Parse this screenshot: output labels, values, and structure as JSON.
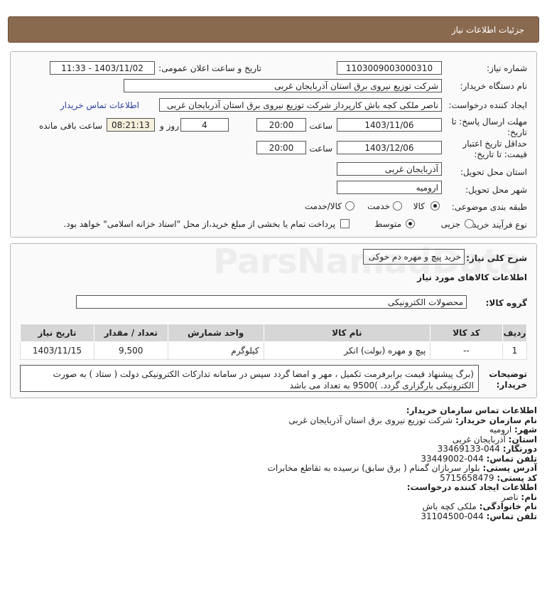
{
  "header": {
    "title": "جزئیات اطلاعات نیاز"
  },
  "form": {
    "need_number_label": "شماره نیاز:",
    "need_number": "1103009003000310",
    "announce_label": "تاریخ و ساعت اعلان عمومی:",
    "announce_value": "1403/11/02 - 11:33",
    "buyer_org_label": "نام دستگاه خریدار:",
    "buyer_org": "شرکت توزیع نیروی برق استان آذربایجان غربی",
    "creator_label": "ایجاد کننده درخواست:",
    "creator": "ناصر ملکی کچه باش کارپرداز شرکت توزیع نیروی برق استان آذربایجان غربی",
    "buyer_contact_link": "اطلاعات تماس خریدار",
    "deadline_label_1": "مهلت ارسال پاسخ: تا",
    "deadline_label_2": "تاریخ:",
    "deadline_date": "1403/11/06",
    "time_label": "ساعت",
    "deadline_time": "20:00",
    "days_value": "4",
    "days_label": "روز و",
    "remaining_time": "08:21:13",
    "remaining_label": "ساعت باقی مانده",
    "validity_label_1": "حداقل تاریخ اعتبار",
    "validity_label_2": "قیمت: تا تاریخ:",
    "validity_date": "1403/12/06",
    "validity_time": "20:00",
    "province_label": "استان محل تحویل:",
    "province": "آذربایجان غربی",
    "city_label": "شهر محل تحویل:",
    "city": "ارومیه",
    "category_label": "طبقه بندی موضوعی:",
    "category_options": [
      "کالا",
      "خدمت",
      "کالا/خدمت"
    ],
    "category_selected": "کالا",
    "process_label": "نوع فرآیند خرید :",
    "process_options": [
      "جزیی",
      "متوسط"
    ],
    "process_selected": "متوسط",
    "payment_note": "پرداخت تمام یا بخشی از مبلغ خرید،از محل \"اسناد خزانه اسلامی\" خواهد بود."
  },
  "need": {
    "desc_label": "شرح کلی نیاز:",
    "desc": "خرید پیچ و مهره دم خوکی",
    "goods_info_title": "اطلاعات کالاهای مورد نیاز",
    "group_label": "گروه کالا:",
    "group_value": "محصولات الکترونیکی",
    "table": {
      "headers": [
        "ردیف",
        "کد کالا",
        "نام کالا",
        "واحد شمارش",
        "تعداد / مقدار",
        "تاریخ نیاز"
      ],
      "rows": [
        [
          "1",
          "--",
          "پیچ و مهره (بولت) انکر",
          "کیلوگرم",
          "9,500",
          "1403/11/15"
        ]
      ]
    },
    "notes_label_1": "توضیحات",
    "notes_label_2": "خریدار:",
    "notes": "(برگ پیشنهاد قیمت برابرفرمت تکمیل ، مهر و امضا گردد سپس در سامانه تدارکات الکترونیکی دولت ( ستاد ) به صورت الکترونیکی بارگزاری گردد. )9500 به تعداد می باشد"
  },
  "contact": {
    "title": "اطلاعات تماس سازمان خریدار:",
    "org_label": "نام سازمان خریدار:",
    "org": "شرکت توزیع نیروی برق استان آذربایجان غربی",
    "city_label": "شهر:",
    "city": "ارومیه",
    "province_label": "استان:",
    "province": "آذربایجان غربی",
    "fax_label": "دورنگار:",
    "fax": "044-33469133",
    "phone_label": "تلفن تماس:",
    "phone": "044-33449002",
    "address_label": "آدرس پستی:",
    "address": "بلوار سربازان گمنام ( برق سابق) نرسیده به تقاطع مخابرات",
    "postal_label": "کد پستی:",
    "postal": "5715658479",
    "creator_title": "اطلاعات ایجاد کننده درخواست:",
    "first_name_label": "نام:",
    "first_name": "ناصر",
    "last_name_label": "نام خانوادگی:",
    "last_name": "ملکی کچه باش",
    "creator_phone_label": "تلفن تماس:",
    "creator_phone": "044-31104500"
  },
  "colors": {
    "header_bg": "#8a6a4f",
    "link": "#2a3f9e",
    "timer_bg": "#f5f0dc",
    "table_header": "#d6d6d6"
  }
}
